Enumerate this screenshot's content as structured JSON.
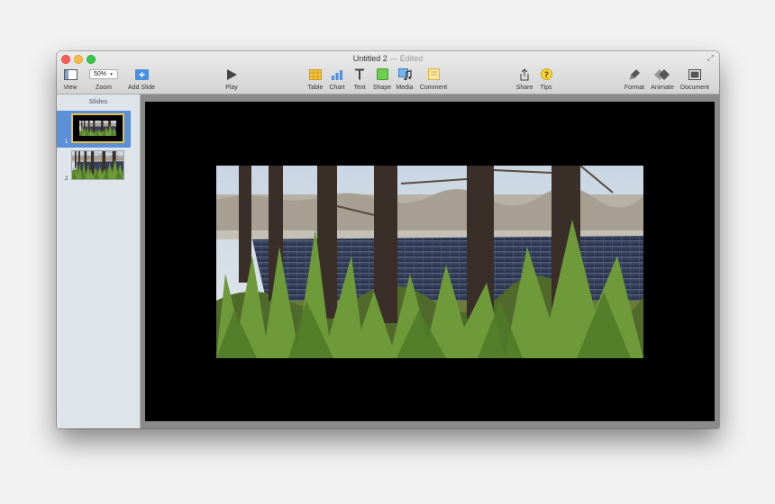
{
  "window": {
    "title": "Untitled 2",
    "status": "— Edited"
  },
  "toolbar": {
    "view_label": "View",
    "zoom_value": "50%",
    "zoom_label": "Zoom",
    "add_slide_label": "Add Slide",
    "play_label": "Play",
    "table_label": "Table",
    "chart_label": "Chart",
    "text_label": "Text",
    "shape_label": "Shape",
    "media_label": "Media",
    "comment_label": "Comment",
    "share_label": "Share",
    "tips_label": "Tips",
    "format_label": "Format",
    "animate_label": "Animate",
    "document_label": "Document"
  },
  "sidebar": {
    "title": "Slides",
    "slides": [
      {
        "number": "1",
        "selected": true
      },
      {
        "number": "2",
        "selected": false
      }
    ]
  },
  "colors": {
    "accent": "#5a8fd9",
    "thumb_selected_border": "#e9c13a",
    "slide_background": "#000000",
    "canvas_background": "#8a8a8a"
  },
  "icons": [
    "view-icon",
    "add-slide-icon",
    "play-icon",
    "table-icon",
    "chart-icon",
    "text-icon",
    "shape-icon",
    "media-icon",
    "comment-icon",
    "share-icon",
    "tips-icon",
    "format-icon",
    "animate-icon",
    "document-icon"
  ]
}
